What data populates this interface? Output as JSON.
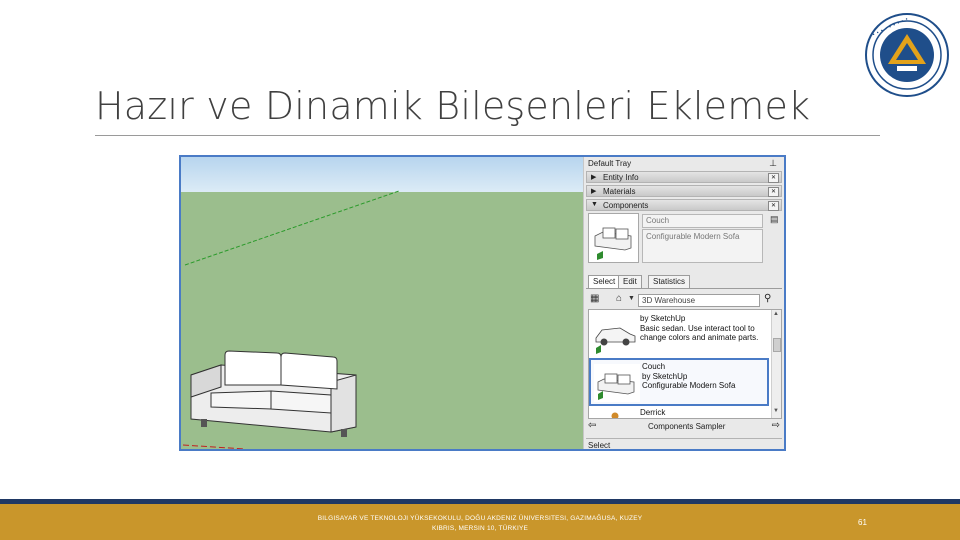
{
  "slide": {
    "title": "Hazır ve Dinamik Bileşenleri Eklemek",
    "footer_line1": "BILGISAYAR VE TEKNOLOJI YÜKSEKOKULU, DOĞU AKDENIZ ÜNIVERSITESI, GAZIMAĞUSA, KUZEY",
    "footer_line2": "KIBRIS, MERSIN 10, TÜRKIYE",
    "page_number": "61"
  },
  "colors": {
    "footer": "#c9962b",
    "footer_line": "#1f3864",
    "ground": "#9bbe8d",
    "selection": "#4a7bc6"
  },
  "tray": {
    "title": "Default Tray",
    "pin_icon": "pin-icon",
    "panels": [
      {
        "label": "Entity Info",
        "expanded": false
      },
      {
        "label": "Materials",
        "expanded": false
      },
      {
        "label": "Components",
        "expanded": true
      }
    ]
  },
  "component": {
    "name": "Couch",
    "description": "Configurable Modern Sofa"
  },
  "tabs": [
    "Select",
    "Edit",
    "Statistics"
  ],
  "search": {
    "value": "3D Warehouse"
  },
  "list": [
    {
      "title": "",
      "author": "by SketchUp",
      "desc": "Basic sedan.  Use interact tool to change colors and animate parts.",
      "thumb": "car"
    },
    {
      "title": "Couch",
      "author": "by SketchUp",
      "desc": "Configurable Modern Sofa",
      "thumb": "sofa",
      "selected": true
    },
    {
      "title": "Derrick",
      "author": "",
      "desc": "",
      "thumb": "person"
    }
  ],
  "nav": {
    "label": "Components Sampler"
  },
  "bottom_label": "Select"
}
